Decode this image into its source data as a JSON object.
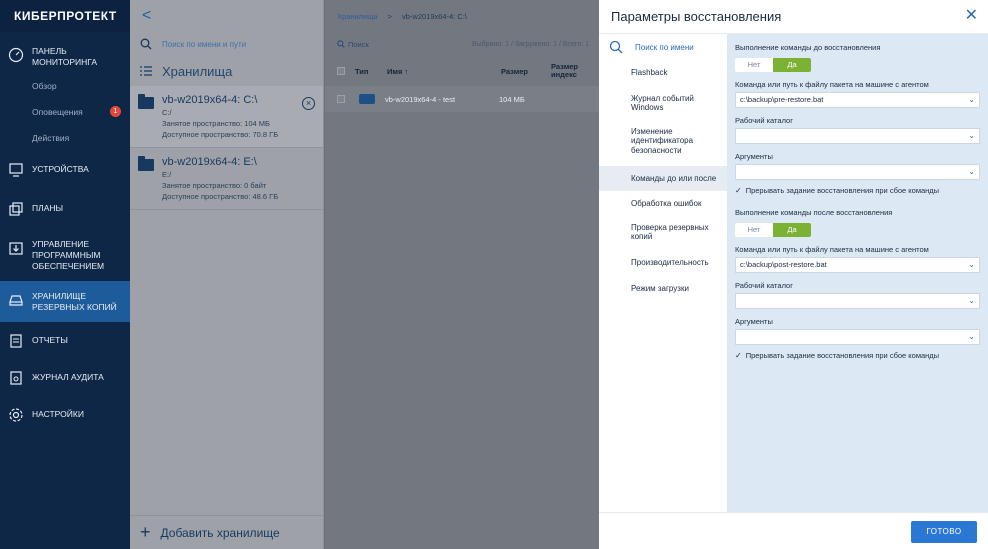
{
  "sidebar": {
    "logo": "КИБЕРПРОТЕКТ",
    "items": [
      {
        "label": "ПАНЕЛЬ МОНИТОРИНГА",
        "icon": "gauge-icon"
      },
      {
        "label": "Обзор"
      },
      {
        "label": "Оповещения",
        "badge": "1"
      },
      {
        "label": "Действия"
      },
      {
        "label": "УСТРОЙСТВА",
        "icon": "monitor-icon"
      },
      {
        "label": "ПЛАНЫ",
        "icon": "plans-icon"
      },
      {
        "label": "УПРАВЛЕНИЕ ПРОГРАММНЫМ ОБЕСПЕЧЕНИЕМ",
        "icon": "software-icon"
      },
      {
        "label": "ХРАНИЛИЩЕ РЕЗЕРВНЫХ КОПИЙ",
        "icon": "storage-icon",
        "active": true
      },
      {
        "label": "ОТЧЕТЫ",
        "icon": "reports-icon"
      },
      {
        "label": "ЖУРНАЛ АУДИТА",
        "icon": "audit-icon"
      },
      {
        "label": "НАСТРОЙКИ",
        "icon": "gear-icon"
      }
    ]
  },
  "storages": {
    "back": "<",
    "search_placeholder": "Поиск по имени и пути",
    "heading": "Хранилища",
    "items": [
      {
        "title": "vb-w2019x64-4: C:\\",
        "path": "C:/",
        "used": "Занятое пространство: 104 МБ",
        "free": "Доступное пространство: 70.8 ГБ"
      },
      {
        "title": "vb-w2019x64-4: E:\\",
        "path": "E:/",
        "used": "Занятое пространство: 0 байт",
        "free": "Доступное пространство: 48.6 ГБ"
      }
    ],
    "add_label": "Добавить хранилище"
  },
  "backups": {
    "breadcrumb_root": "Хранилища",
    "breadcrumb_sep": ">",
    "breadcrumb_current": "vb-w2019x64-4: C:\\",
    "search": "Поиск",
    "counter": "Выбрано: 1 / Загружено: 1 / Всего: 1",
    "columns": [
      "Тип",
      "Имя ↑",
      "Размер",
      "Размер индекс"
    ],
    "rows": [
      {
        "name": "vb-w2019x64-4 - test",
        "size": "104 МБ"
      }
    ]
  },
  "modal": {
    "title": "Параметры восстановления",
    "nav": [
      "Поиск по имени",
      "Flashback",
      "Журнал событий Windows",
      "Изменение идентификатора безопасности",
      "Команды до или после",
      "Обработка ошибок",
      "Проверка резервных копий",
      "Производительность",
      "Режим загрузки"
    ],
    "pre": {
      "section": "Выполнение команды до восстановления",
      "toggle_off": "Нет",
      "toggle_on": "Да",
      "cmd_label": "Команда или путь к файлу пакета на машине с агентом",
      "cmd_value": "c:\\backup\\pre-restore.bat",
      "dir_label": "Рабочий каталог",
      "dir_value": "",
      "args_label": "Аргументы",
      "args_value": "",
      "check_label": "Прерывать задание восстановления при сбое команды"
    },
    "post": {
      "section": "Выполнение команды после восстановления",
      "toggle_off": "Нет",
      "toggle_on": "Да",
      "cmd_label": "Команда или путь к файлу пакета на машине с агентом",
      "cmd_value": "c:\\backup\\post-restore.bat",
      "dir_label": "Рабочий каталог",
      "dir_value": "",
      "args_label": "Аргументы",
      "args_value": "",
      "check_label": "Прерывать задание восстановления при сбое команды"
    },
    "done_label": "ГОТОВО"
  },
  "colors": {
    "sidebar_bg": "#0e2746",
    "sidebar_active": "#1e5b9a",
    "accent": "#2b78d4",
    "toggle_on": "#7cb233",
    "content_bg": "#dde8f5",
    "badge": "#e2483a"
  }
}
